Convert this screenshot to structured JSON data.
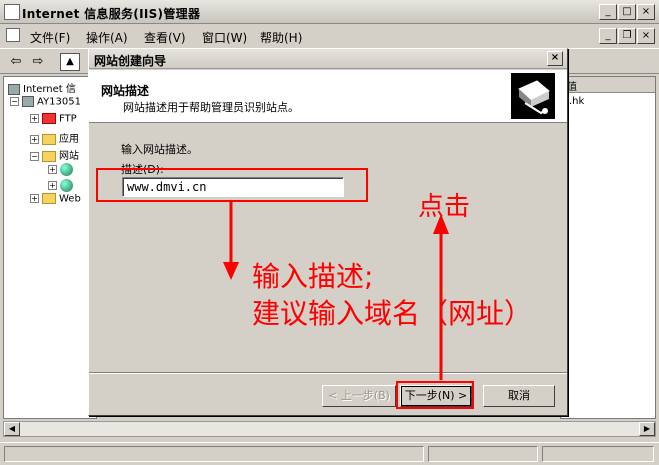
{
  "window": {
    "title": "Internet 信息服务(IIS)管理器",
    "min_glyph": "_",
    "max_glyph": "□",
    "close_glyph": "×",
    "restore_glyph": "❐"
  },
  "menu": [
    "文件(F)",
    "操作(A)",
    "查看(V)",
    "窗口(W)",
    "帮助(H)"
  ],
  "tree": {
    "root": "Internet 信",
    "server": "AY13051",
    "items": [
      "FTP",
      "应用",
      "网站",
      "",
      "",
      "Web"
    ]
  },
  "right_pane": {
    "header_partial": "值",
    "cell_partial": ".hk"
  },
  "wizard": {
    "title": "网站创建向导",
    "header_title": "网站描述",
    "header_subtitle": "网站描述用于帮助管理员识别站点。",
    "body_text": "输入网站描述。",
    "field_label": "描述(D):",
    "field_value": "www.dmvi.cn",
    "back_label": "< 上一步(B)",
    "next_label": "下一步(N) >",
    "cancel_label": "取消"
  },
  "annotations": {
    "click": "点击",
    "input_line1": "输入描述;",
    "input_line2": "建议输入域名（网址）"
  },
  "colors": {
    "annotation": "#ff0000",
    "dialog_bg": "#d4d0c8"
  }
}
